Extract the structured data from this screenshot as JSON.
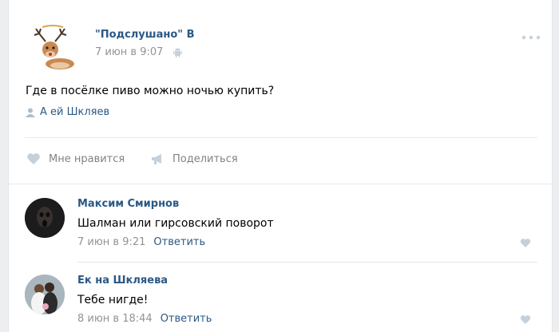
{
  "post": {
    "group_name": "\"Подслушано\" В",
    "time": "7 июн в 9:07",
    "text": "Где в посёлке пиво можно ночью купить?",
    "author": "А        ей Шкляев",
    "actions": {
      "like_label": "Мне нравится",
      "share_label": "Поделиться"
    }
  },
  "comments": [
    {
      "author": "Максим Смирнов",
      "text": "Шалман или гирсовский поворот",
      "time": "7 июн в 9:21",
      "reply_label": "Ответить"
    },
    {
      "author": "Ек          на Шкляева",
      "text": "Тебе нигде!",
      "time": "8 июн в 18:44",
      "reply_label": "Ответить"
    }
  ],
  "icons": {
    "more": "more-dots-icon",
    "platform": "android-icon",
    "user": "user-icon",
    "like": "heart-icon",
    "share": "megaphone-icon"
  },
  "colors": {
    "link": "#2a5885",
    "muted": "#939393",
    "icon": "#c5d0db",
    "page_bg": "#edeef0"
  }
}
